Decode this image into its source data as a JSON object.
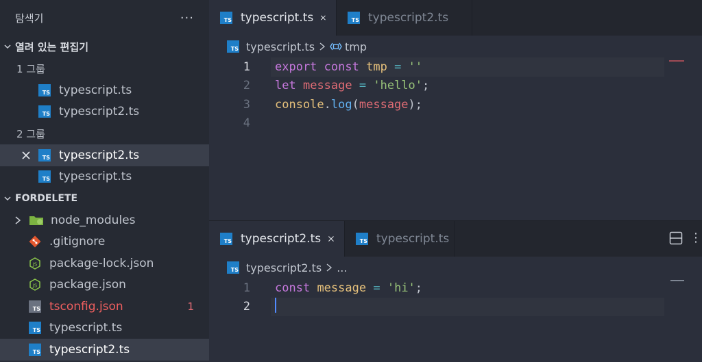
{
  "sidebar": {
    "title": "탐색기",
    "more": "···",
    "open_editors": {
      "title": "열려 있는 편집기",
      "groups": [
        {
          "label": "1 그룹",
          "items": [
            "typescript.ts",
            "typescript2.ts"
          ]
        },
        {
          "label": "2 그룹",
          "items": [
            "typescript2.ts",
            "typescript.ts"
          ]
        }
      ]
    },
    "folder": {
      "title": "FORDELETE",
      "items": [
        "node_modules",
        ".gitignore",
        "package-lock.json",
        "package.json",
        "tsconfig.json",
        "typescript.ts",
        "typescript2.ts"
      ],
      "error_count": "1"
    }
  },
  "editor1": {
    "tabs": [
      "typescript.ts",
      "typescript2.ts"
    ],
    "breadcrumb": {
      "file": "typescript.ts",
      "symbol": "tmp"
    },
    "line_numbers": [
      "1",
      "2",
      "3",
      "4"
    ],
    "code": {
      "l1": [
        "export",
        "const",
        "tmp",
        "=",
        "''"
      ],
      "l2": [
        "let",
        "message",
        "=",
        "'hello'",
        ";"
      ],
      "l3": [
        "console",
        ".",
        "log",
        "(",
        "message",
        ")",
        ";"
      ]
    }
  },
  "editor2": {
    "tabs": [
      "typescript2.ts",
      "typescript.ts"
    ],
    "breadcrumb": {
      "file": "typescript2.ts",
      "rest": "..."
    },
    "line_numbers": [
      "1",
      "2"
    ],
    "code": {
      "l1": [
        "const",
        "message",
        "=",
        "'hi'",
        ";"
      ]
    }
  },
  "icons": {
    "ts_label": "TS"
  },
  "colors": {
    "ts_blue": "#1f7fc8",
    "error_red": "#ef5f5f",
    "keyword": "#c678dd",
    "variable": "#e06c75",
    "string": "#98c379"
  }
}
